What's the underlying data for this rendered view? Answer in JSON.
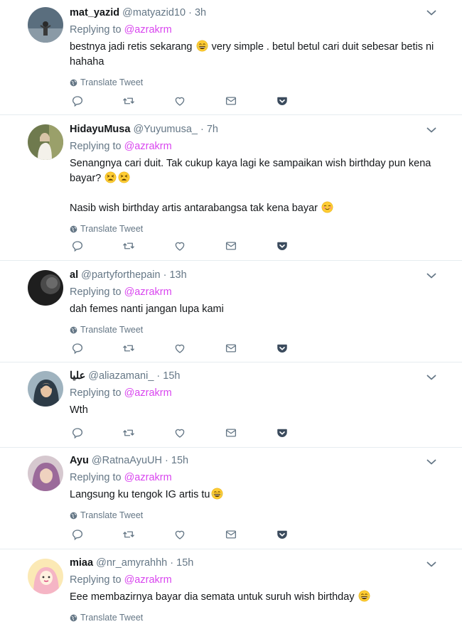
{
  "tweets": [
    {
      "name": "mat_yazid",
      "handle": "@matyazid10",
      "time": "3h",
      "replying_label": "Replying to",
      "replying_to": "@azrakrm",
      "lines": [
        "bestnya jadi retis sekarang",
        "very simple . betul betul cari duit sebesar betis ni hahaha"
      ],
      "translate": "Translate Tweet",
      "avatar_color": "#5a6e7e"
    },
    {
      "name": "HidayuMusa",
      "handle": "@Yuyumusa_",
      "time": "7h",
      "replying_label": "Replying to",
      "replying_to": "@azrakrm",
      "para1": "Senangnya cari duit. Tak cukup kaya lagi ke sampaikan wish birthday pun kena bayar?",
      "para2": "Nasib wish birthday artis antarabangsa tak kena bayar",
      "translate": "Translate Tweet",
      "avatar_color": "#8a7a5a"
    },
    {
      "name": "al",
      "handle": "@partyforthepain",
      "time": "13h",
      "replying_label": "Replying to",
      "replying_to": "@azrakrm",
      "text": "dah femes nanti jangan lupa kami",
      "translate": "Translate Tweet",
      "avatar_color": "#2b2b2b"
    },
    {
      "name": "عليا",
      "handle": "@aliazamani_",
      "time": "15h",
      "replying_label": "Replying to",
      "replying_to": "@azrakrm",
      "text": "Wth",
      "avatar_color": "#3a4a55"
    },
    {
      "name": "Ayu",
      "handle": "@RatnaAyuUH",
      "time": "15h",
      "replying_label": "Replying to",
      "replying_to": "@azrakrm",
      "text": "Langsung ku tengok IG artis tu",
      "translate": "Translate Tweet",
      "avatar_color": "#b894a8"
    },
    {
      "name": "miaa",
      "handle": "@nr_amyrahhh",
      "time": "15h",
      "replying_label": "Replying to",
      "replying_to": "@azrakrm",
      "text": "Eee membazirnya bayar dia semata untuk suruh wish birthday",
      "translate": "Translate Tweet",
      "avatar_color": "#f3d36b"
    }
  ],
  "separator": "·",
  "icons": {
    "reply": "reply-icon",
    "retweet": "retweet-icon",
    "like": "heart-icon",
    "message": "envelope-icon",
    "pocket": "pocket-icon",
    "more": "chevron-down-icon",
    "translate": "globe-icon"
  },
  "colors": {
    "link": "#d946ef",
    "muted": "#657786",
    "pocket": "#3b4b5d"
  }
}
